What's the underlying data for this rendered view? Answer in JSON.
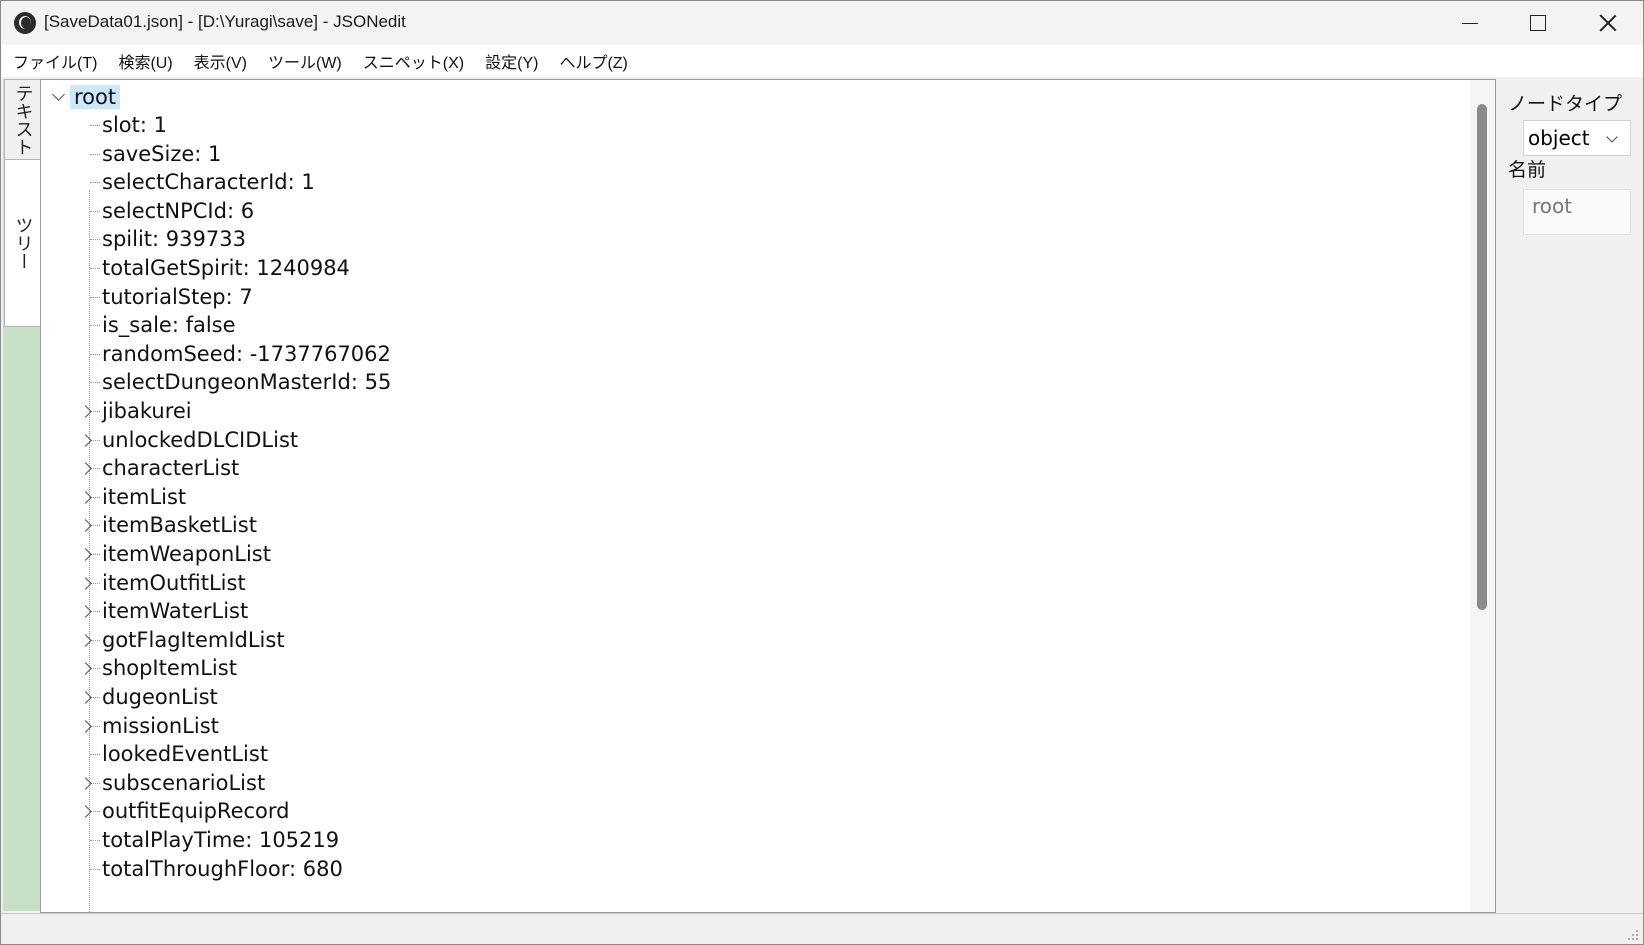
{
  "window": {
    "title": "[SaveData01.json] - [D:\\Yuragi\\save] - JSONedit"
  },
  "menu": {
    "items": [
      "ファイル(T)",
      "検索(U)",
      "表示(V)",
      "ツール(W)",
      "スニペット(X)",
      "設定(Y)",
      "ヘルプ(Z)"
    ]
  },
  "side_tabs": {
    "text": "テキスト",
    "tree": "ツリー"
  },
  "tree": {
    "root": "root",
    "children": [
      {
        "label": "slot: 1",
        "expandable": false
      },
      {
        "label": "saveSize: 1",
        "expandable": false
      },
      {
        "label": "selectCharacterId: 1",
        "expandable": false
      },
      {
        "label": "selectNPCId: 6",
        "expandable": false
      },
      {
        "label": "spilit: 939733",
        "expandable": false
      },
      {
        "label": "totalGetSpirit: 1240984",
        "expandable": false
      },
      {
        "label": "tutorialStep: 7",
        "expandable": false
      },
      {
        "label": "is_sale: false",
        "expandable": false
      },
      {
        "label": "randomSeed: -1737767062",
        "expandable": false
      },
      {
        "label": "selectDungeonMasterId: 55",
        "expandable": false
      },
      {
        "label": "jibakurei",
        "expandable": true
      },
      {
        "label": "unlockedDLCIDList",
        "expandable": true
      },
      {
        "label": "characterList",
        "expandable": true
      },
      {
        "label": "itemList",
        "expandable": true
      },
      {
        "label": "itemBasketList",
        "expandable": true
      },
      {
        "label": "itemWeaponList",
        "expandable": true
      },
      {
        "label": "itemOutfitList",
        "expandable": true
      },
      {
        "label": "itemWaterList",
        "expandable": true
      },
      {
        "label": "gotFlagItemIdList",
        "expandable": true
      },
      {
        "label": "shopItemList",
        "expandable": true
      },
      {
        "label": "dugeonList",
        "expandable": true
      },
      {
        "label": "missionList",
        "expandable": true
      },
      {
        "label": "lookedEventList",
        "expandable": false
      },
      {
        "label": "subscenarioList",
        "expandable": true
      },
      {
        "label": "outfitEquipRecord",
        "expandable": true
      },
      {
        "label": "totalPlayTime: 105219",
        "expandable": false
      },
      {
        "label": "totalThroughFloor: 680",
        "expandable": false
      }
    ]
  },
  "right_panel": {
    "node_type_label": "ノードタイプ",
    "node_type_value": "object",
    "name_label": "名前",
    "name_value": "root"
  }
}
